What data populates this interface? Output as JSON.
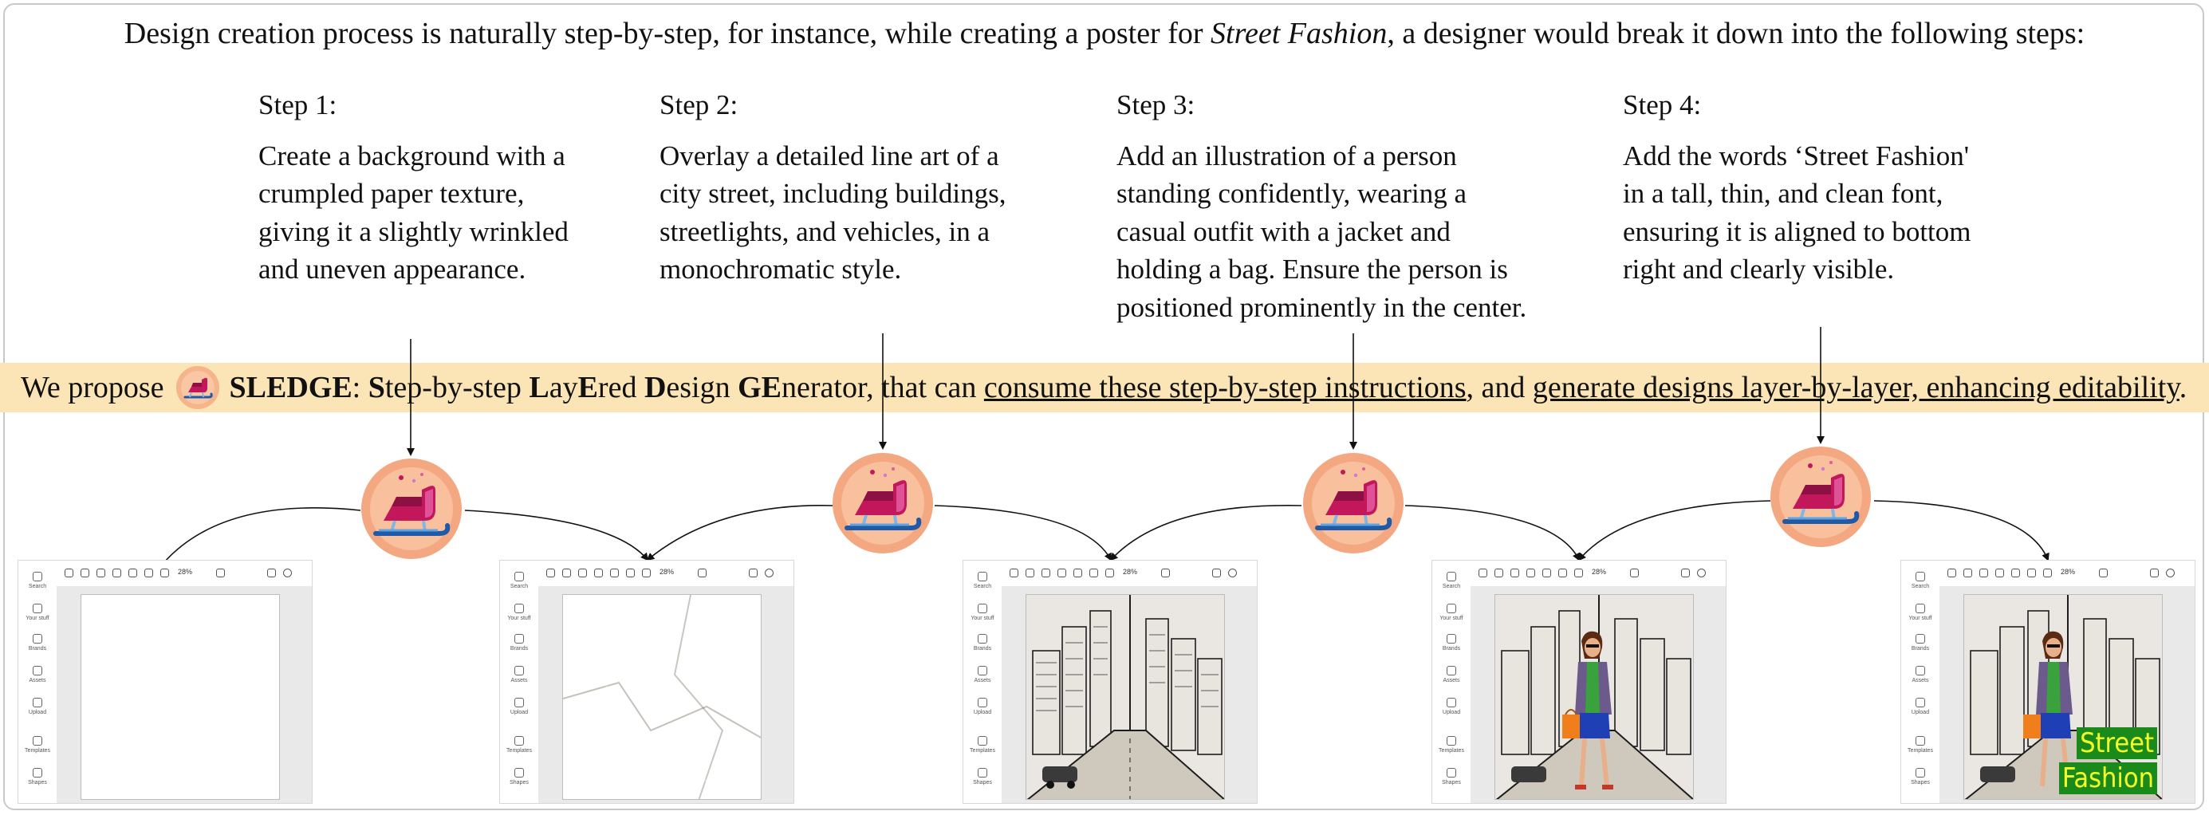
{
  "intro": {
    "before": "Design creation process is naturally step-by-step, for instance, while creating a poster for ",
    "italic": "Street Fashion",
    "after": ", a designer would break it down into the following steps:"
  },
  "steps": [
    {
      "title": "Step 1:",
      "lines": [
        "Create a background with a",
        "crumpled paper texture,",
        "giving it a slightly wrinkled",
        "and uneven appearance."
      ]
    },
    {
      "title": "Step 2:",
      "lines": [
        "Overlay a detailed line art of a",
        "city street, including buildings,",
        "streetlights, and vehicles, in a",
        "monochromatic style."
      ]
    },
    {
      "title": "Step 3:",
      "lines": [
        "Add an illustration of a person",
        "standing confidently, wearing a",
        "casual outfit with a jacket and",
        "holding a bag. Ensure the person is",
        "positioned prominently in the center."
      ]
    },
    {
      "title": "Step 4:",
      "lines": [
        "Add the words ‘Street Fashion'",
        "in a tall, thin, and clean font,",
        "ensuring it is aligned to bottom",
        "right and clearly visible."
      ]
    }
  ],
  "banner": {
    "we_propose": "We propose",
    "name": "SLEDGE",
    "colon": ": ",
    "s_bold": "S",
    "s_rest": "tep-by-step ",
    "l_bold": "L",
    "ay": "ay",
    "e_bold": "E",
    "red": "red ",
    "d_bold": "D",
    "esign": "esign ",
    "ge_bold": "GE",
    "nerator": "nerator, that can ",
    "consume": "consume these step-by-step instructions",
    "and": ", and ",
    "generate": "generate designs layer-by-layer, enhancing editability",
    "end": "."
  },
  "editor": {
    "sidebar": [
      "Search",
      "Your stuff",
      "Brands",
      "Assets",
      "Upload",
      "Templates",
      "Shapes"
    ],
    "zoom": "28%"
  },
  "poster_text": [
    "Street",
    "Fashion"
  ],
  "colors": {
    "banner": "#fbe5b6",
    "sled_badge": "#f6b48a",
    "sled_body": "#c2185b",
    "poster_text_bg": "#1a8a1a",
    "poster_text_fg": "#f4ff2a"
  }
}
